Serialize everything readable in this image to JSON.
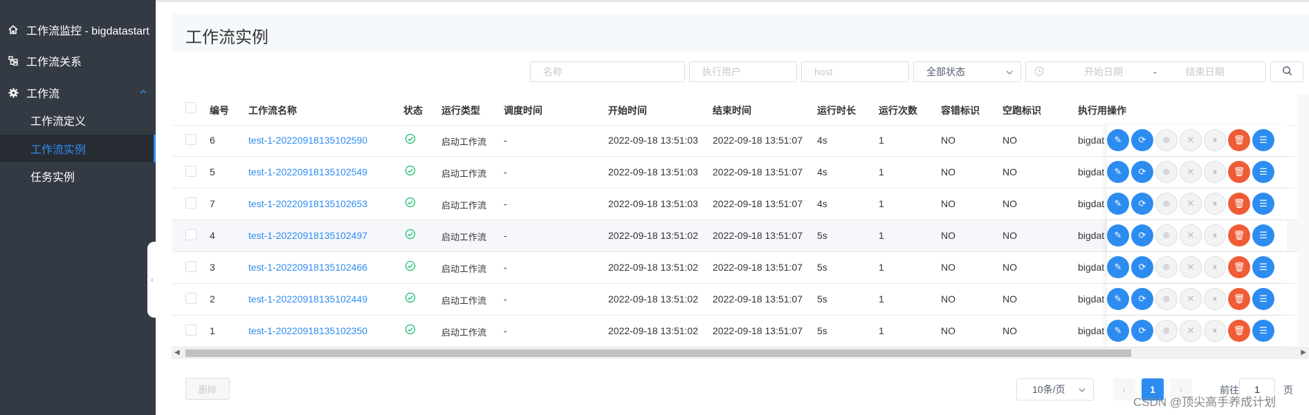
{
  "sidebar": {
    "items": [
      {
        "label": "工作流监控 - bigdatastart",
        "icon": "home-icon"
      },
      {
        "label": "工作流关系",
        "icon": "relation-icon"
      },
      {
        "label": "工作流",
        "icon": "gear-icon"
      },
      {
        "label": "工作流定义"
      },
      {
        "label": "工作流实例"
      },
      {
        "label": "任务实例"
      }
    ]
  },
  "page": {
    "title": "工作流实例"
  },
  "filters": {
    "name_placeholder": "名称",
    "user_placeholder": "执行用户",
    "host_placeholder": "host",
    "status_value": "全部状态",
    "start_date_placeholder": "开始日期",
    "date_separator": "-",
    "end_date_placeholder": "结束日期"
  },
  "table": {
    "headers": {
      "id": "编号",
      "name": "工作流名称",
      "status": "状态",
      "run_type": "运行类型",
      "schedule_time": "调度时间",
      "start_time": "开始时间",
      "end_time": "结束时间",
      "duration": "运行时长",
      "run_times": "运行次数",
      "failover": "容错标识",
      "dry_run": "空跑标识",
      "executor": "执行用",
      "ops": "操作"
    },
    "rows": [
      {
        "id": "6",
        "name": "test-1-20220918135102590",
        "run_type": "启动工作流",
        "schedule_time": "-",
        "start_time": "2022-09-18 13:51:03",
        "end_time": "2022-09-18 13:51:07",
        "duration": "4s",
        "run_times": "1",
        "failover": "NO",
        "dry_run": "NO",
        "executor": "bigdat"
      },
      {
        "id": "5",
        "name": "test-1-20220918135102549",
        "run_type": "启动工作流",
        "schedule_time": "-",
        "start_time": "2022-09-18 13:51:03",
        "end_time": "2022-09-18 13:51:07",
        "duration": "4s",
        "run_times": "1",
        "failover": "NO",
        "dry_run": "NO",
        "executor": "bigdat"
      },
      {
        "id": "7",
        "name": "test-1-20220918135102653",
        "run_type": "启动工作流",
        "schedule_time": "-",
        "start_time": "2022-09-18 13:51:03",
        "end_time": "2022-09-18 13:51:07",
        "duration": "4s",
        "run_times": "1",
        "failover": "NO",
        "dry_run": "NO",
        "executor": "bigdat"
      },
      {
        "id": "4",
        "name": "test-1-20220918135102497",
        "run_type": "启动工作流",
        "schedule_time": "-",
        "start_time": "2022-09-18 13:51:02",
        "end_time": "2022-09-18 13:51:07",
        "duration": "5s",
        "run_times": "1",
        "failover": "NO",
        "dry_run": "NO",
        "executor": "bigdat"
      },
      {
        "id": "3",
        "name": "test-1-20220918135102466",
        "run_type": "启动工作流",
        "schedule_time": "-",
        "start_time": "2022-09-18 13:51:02",
        "end_time": "2022-09-18 13:51:07",
        "duration": "5s",
        "run_times": "1",
        "failover": "NO",
        "dry_run": "NO",
        "executor": "bigdat"
      },
      {
        "id": "2",
        "name": "test-1-20220918135102449",
        "run_type": "启动工作流",
        "schedule_time": "-",
        "start_time": "2022-09-18 13:51:02",
        "end_time": "2022-09-18 13:51:07",
        "duration": "5s",
        "run_times": "1",
        "failover": "NO",
        "dry_run": "NO",
        "executor": "bigdat"
      },
      {
        "id": "1",
        "name": "test-1-20220918135102350",
        "run_type": "启动工作流",
        "schedule_time": "-",
        "start_time": "2022-09-18 13:51:02",
        "end_time": "2022-09-18 13:51:07",
        "duration": "5s",
        "run_times": "1",
        "failover": "NO",
        "dry_run": "NO",
        "executor": "bigdat"
      }
    ]
  },
  "footer": {
    "delete_label": "删除",
    "page_size": "10条/页",
    "current_page": "1",
    "goto_prefix": "前往",
    "goto_value": "1",
    "goto_suffix": "页"
  },
  "watermark": "CSDN @顶尖高手养成计划",
  "colors": {
    "accent": "#2d8cf0",
    "danger": "#ed4014",
    "success": "#19be6b",
    "sidebar": "#343a43"
  }
}
